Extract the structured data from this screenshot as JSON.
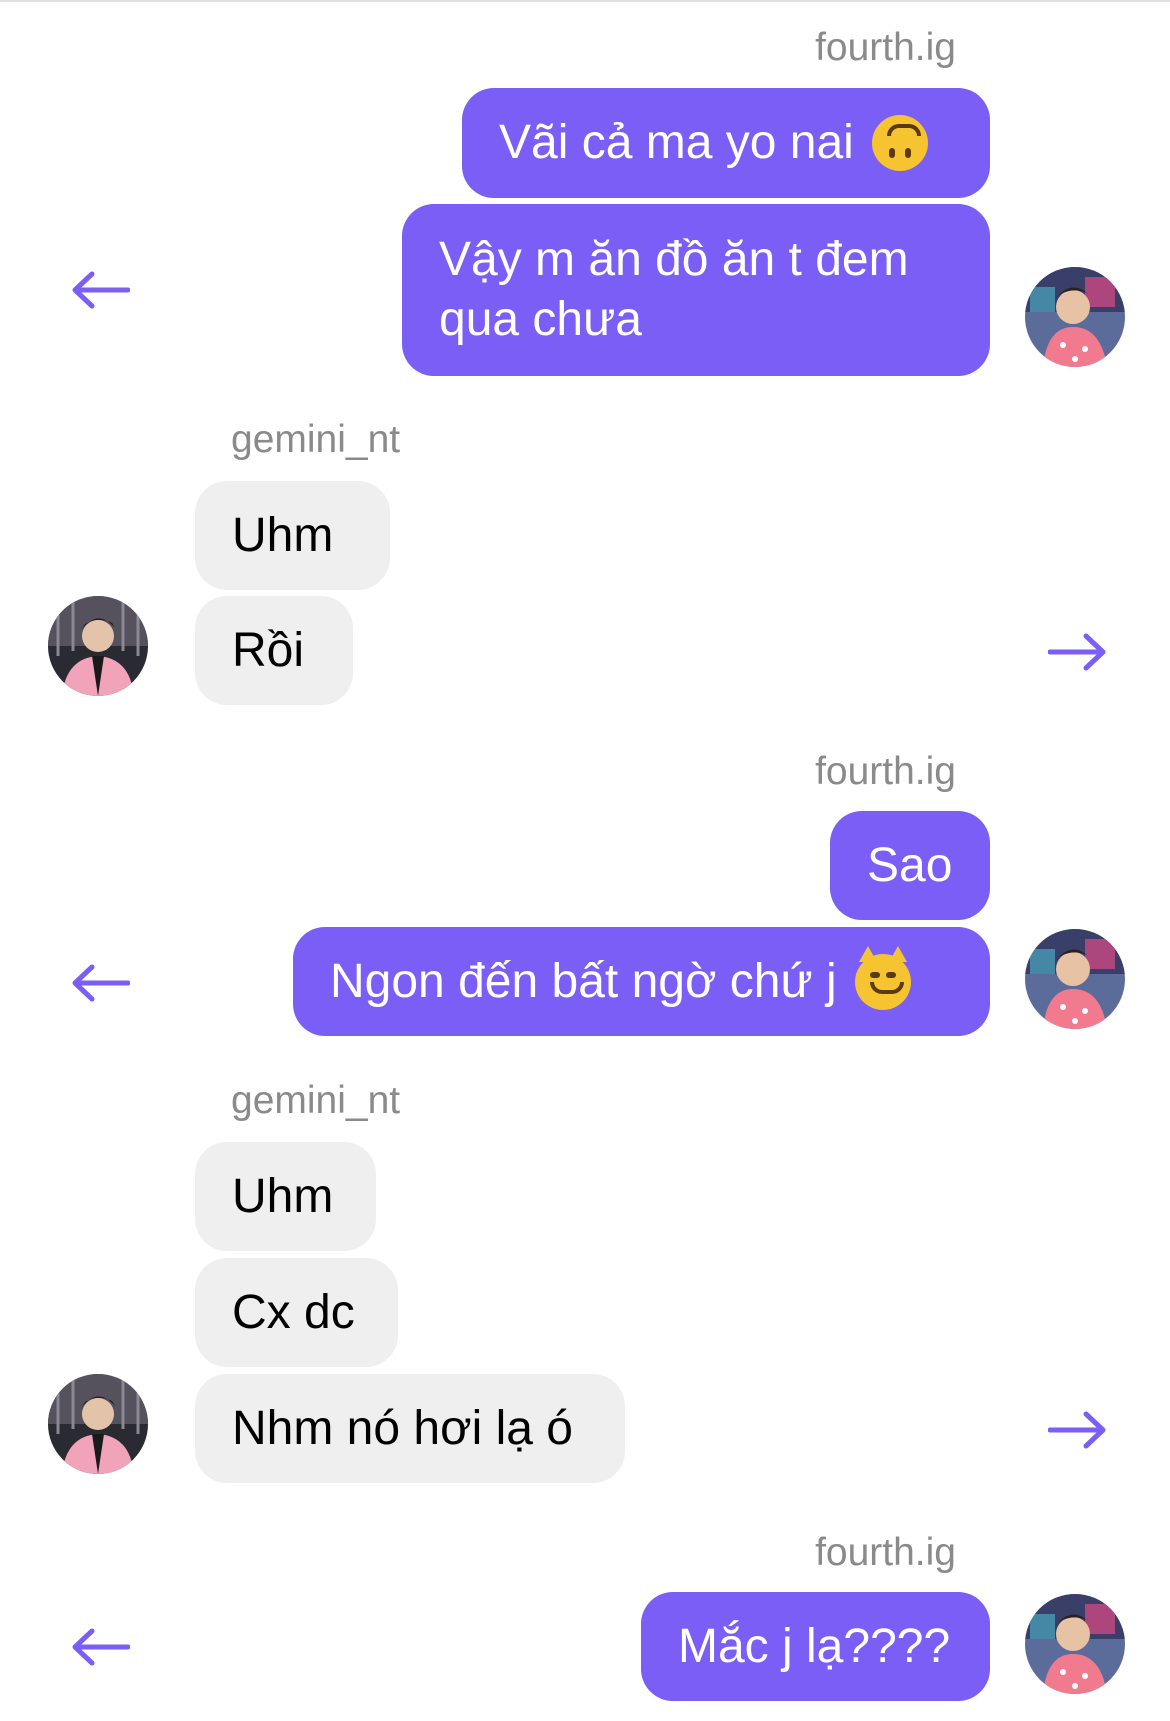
{
  "colors": {
    "outgoing_bubble": "#7a5ef5",
    "incoming_bubble": "#efefef",
    "arrow": "#7a5ef5",
    "sender_name": "#8a8a8a"
  },
  "groups": [
    {
      "direction": "outgoing",
      "sender": "fourth.ig",
      "messages": [
        {
          "text": "Vãi cả ma yo nai",
          "emoji": "upside-down-face-emoji"
        },
        {
          "line1": "Vậy m ăn đồ ăn t đem",
          "line2": "qua chưa"
        }
      ],
      "share_icon": "arrow-left-icon"
    },
    {
      "direction": "incoming",
      "sender": "gemini_nt",
      "messages": [
        {
          "text": "Uhm"
        },
        {
          "text": "Rồi"
        }
      ],
      "share_icon": "arrow-right-icon"
    },
    {
      "direction": "outgoing",
      "sender": "fourth.ig",
      "messages": [
        {
          "text": "Sao"
        },
        {
          "text": "Ngon đến bất ngờ chứ j",
          "emoji": "smirking-cat-emoji"
        }
      ],
      "share_icon": "arrow-left-icon"
    },
    {
      "direction": "incoming",
      "sender": "gemini_nt",
      "messages": [
        {
          "text": "Uhm"
        },
        {
          "text": "Cx dc"
        },
        {
          "text": "Nhm nó hơi lạ ó"
        }
      ],
      "share_icon": "arrow-right-icon"
    },
    {
      "direction": "outgoing",
      "sender": "fourth.ig",
      "messages": [
        {
          "text": "Mắc j lạ????"
        }
      ],
      "share_icon": "arrow-left-icon"
    }
  ]
}
